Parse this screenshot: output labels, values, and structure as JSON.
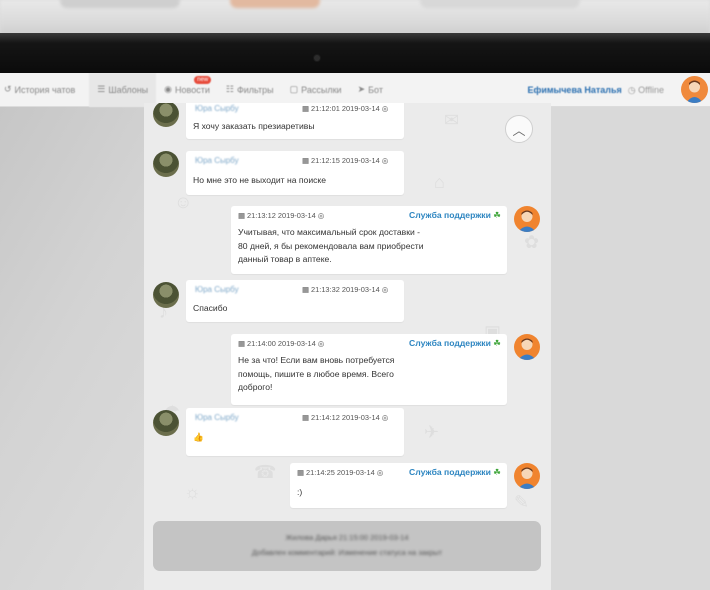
{
  "navbar": {
    "items": [
      {
        "icon": "history-icon",
        "label": "История чатов"
      },
      {
        "icon": "list-icon",
        "label": "Шаблоны"
      },
      {
        "icon": "news-icon",
        "label": "Новости",
        "badge": "new"
      },
      {
        "icon": "filter-icon",
        "label": "Фильтры"
      },
      {
        "icon": "mailing-icon",
        "label": "Рассылки"
      },
      {
        "icon": "bot-icon",
        "label": "Бот"
      }
    ],
    "user_name": "Ефимычева Наталья",
    "status": "Offline"
  },
  "chat": {
    "messages": [
      {
        "from": "client",
        "sender": "Юра Сырбу",
        "time": "21:12:01 2019-03-14",
        "text": "Я хочу заказать презиаретивы"
      },
      {
        "from": "client",
        "sender": "Юра Сырбу",
        "time": "21:12:15 2019-03-14",
        "text": "Но мне это не выходит на поиске"
      },
      {
        "from": "agent",
        "sender": "Служба поддержки",
        "time": "21:13:12 2019-03-14",
        "text_lines": [
          "Учитывая, что максимальный срок доставки -",
          "80 дней, я бы рекомендовала вам приобрести",
          "данный товар в аптеке."
        ]
      },
      {
        "from": "client",
        "sender": "Юра Сырбу",
        "time": "21:13:32 2019-03-14",
        "text": "Спасибо"
      },
      {
        "from": "agent",
        "sender": "Служба поддержки",
        "time": "21:14:00 2019-03-14",
        "text_lines": [
          "Не за что! Если вам вновь потребуется",
          "помощь, пишите в любое время. Всего",
          "доброго!"
        ]
      },
      {
        "from": "client",
        "sender": "Юра Сырбу",
        "time": "21:14:12 2019-03-14",
        "text": "👍"
      },
      {
        "from": "agent",
        "sender": "Служба поддержки",
        "time": "21:14:25 2019-03-14",
        "text": ":)"
      }
    ],
    "system_note": {
      "line1": "Жилова Дарья 21:15:00 2019-03-14",
      "line2": "Добавлен комментарий: Изменение статуса на закрыт"
    }
  },
  "icons": {
    "clock": "clock-icon",
    "eye": "eye-icon",
    "clover": "☘"
  },
  "colors": {
    "agent_name": "#2e86c1",
    "clover": "#3aa335",
    "badge": "#e74c3c",
    "user_name": "#2a6fb0"
  }
}
